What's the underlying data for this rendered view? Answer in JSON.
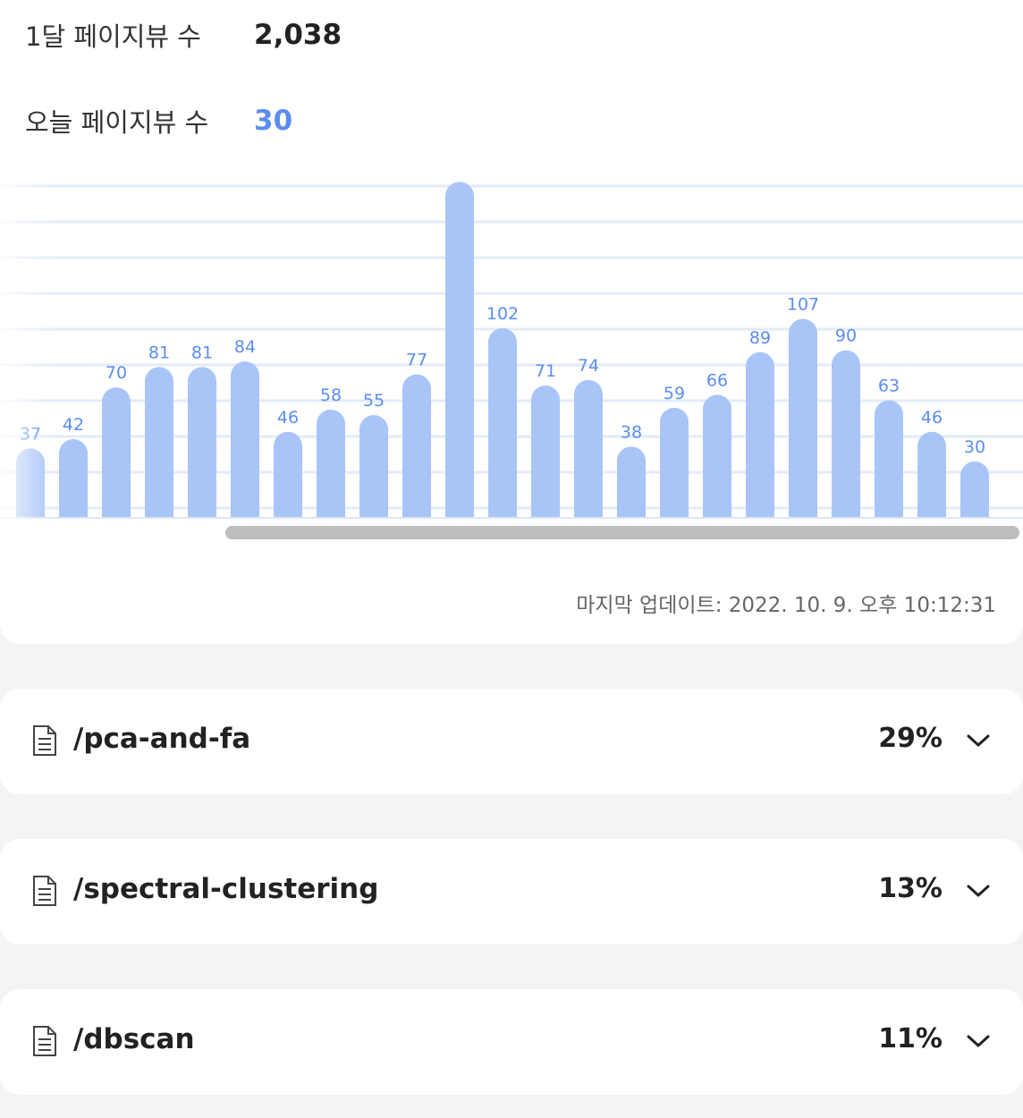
{
  "stats": {
    "month_label": "1달 페이지뷰 수",
    "month_value": "2,038",
    "today_label": "오늘 페이지뷰 수",
    "today_value": "30"
  },
  "chart_data": {
    "type": "bar",
    "values": [
      37,
      42,
      70,
      81,
      81,
      84,
      46,
      58,
      55,
      77,
      181,
      102,
      71,
      74,
      38,
      59,
      66,
      89,
      107,
      90,
      63,
      46,
      30
    ],
    "bar_color": "#a9c5f7",
    "label_color": "#5b8def",
    "grid": true
  },
  "last_update": "마지막 업데이트: 2022. 10. 9. 오후 10:12:31",
  "pages": [
    {
      "path": "/pca-and-fa",
      "percent": "29%",
      "icon": "document-icon"
    },
    {
      "path": "/spectral-clustering",
      "percent": "13%",
      "icon": "document-icon"
    },
    {
      "path": "/dbscan",
      "percent": "11%",
      "icon": "document-icon"
    }
  ],
  "colors": {
    "accent": "#5b8def",
    "background": "#f4f4f4",
    "card": "#ffffff"
  }
}
